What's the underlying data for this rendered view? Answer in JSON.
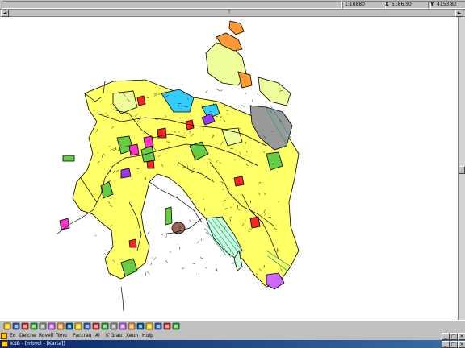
{
  "status": {
    "scale": "1:10880",
    "x_coord": "5186.50",
    "y_coord": "4153.82",
    "x_glyph": "X",
    "y_glyph": "Y"
  },
  "ruler": {
    "left_arrow": "◄",
    "right_arrow": "►",
    "marker": "⊤"
  },
  "menu": {
    "items": [
      "Eo",
      "Delche",
      "Rovell",
      "Tonu",
      "Paccrau",
      "Al",
      "K'Grau",
      "Xeun",
      "Hulp"
    ],
    "minimize": "_",
    "restore": "□",
    "close": "×"
  },
  "title": {
    "text": "KSB - [mbvol - [Karta]]"
  },
  "toolbar": {
    "tools": [
      "open-icon",
      "save-icon",
      "print-icon",
      "pan-icon",
      "zoom-in-icon",
      "zoom-out-icon",
      "select-icon",
      "hand-icon",
      "measure-icon",
      "edit-icon",
      "layer-icon",
      "grid-icon",
      "node-icon",
      "query-icon",
      "info-icon",
      "pin-icon",
      "label-icon",
      "draw-icon",
      "palette-icon",
      "legend-icon"
    ]
  },
  "colors": {
    "parcel_fill": "#ffff66",
    "parcel_light": "#eeff99",
    "forest": "#66cc44",
    "orange": "#ff9933",
    "red": "#ff2222",
    "purple": "#9933ff",
    "magenta": "#ff33cc",
    "cyan": "#33ccff",
    "gray": "#999999",
    "brown": "#996655",
    "teal": "#22aa88",
    "outline": "#000000"
  }
}
